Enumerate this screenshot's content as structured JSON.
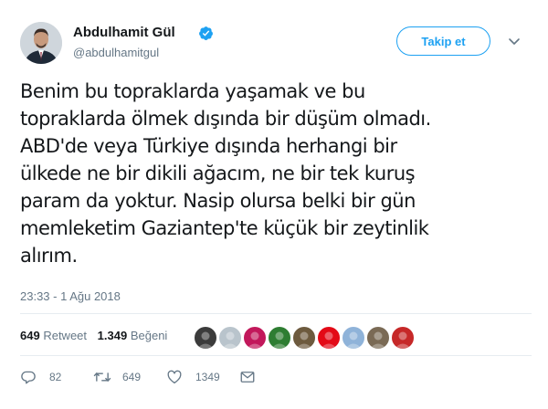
{
  "author": {
    "name": "Abdulhamit Gül",
    "handle": "@abdulhamitgul",
    "verified": true
  },
  "follow_button": {
    "label": "Takip et"
  },
  "tweet": {
    "lines": [
      "Benim bu topraklarda yaşamak ve bu",
      "topraklarda ölmek dışında bir düşüm olmadı.",
      "ABD'de veya Türkiye dışında herhangi bir",
      "ülkede ne bir dikili ağacım, ne bir tek kuruş",
      "param da yoktur. Nasip olursa belki bir gün",
      "memleketim Gaziantep'te küçük bir zeytinlik",
      "alırım."
    ],
    "timestamp": "23:33 - 1 Ağu 2018"
  },
  "stats": {
    "retweet_count": "649",
    "retweet_label": "Retweet",
    "like_count": "1.349",
    "like_label": "Beğeni"
  },
  "likers": [
    {
      "color": "#3b3b3b"
    },
    {
      "color": "#b9c4cc"
    },
    {
      "color": "#c2185b"
    },
    {
      "color": "#2e7d32"
    },
    {
      "color": "#6d5a3e"
    },
    {
      "color": "#e30a17"
    },
    {
      "color": "#8fb3d9"
    },
    {
      "color": "#7a6a55"
    },
    {
      "color": "#c62828"
    }
  ],
  "actions": {
    "reply_count": "82",
    "retweet_count": "649",
    "like_count": "1349"
  },
  "colors": {
    "accent": "#1da1f2",
    "secondary_text": "#657786",
    "divider": "#e6ecf0"
  }
}
